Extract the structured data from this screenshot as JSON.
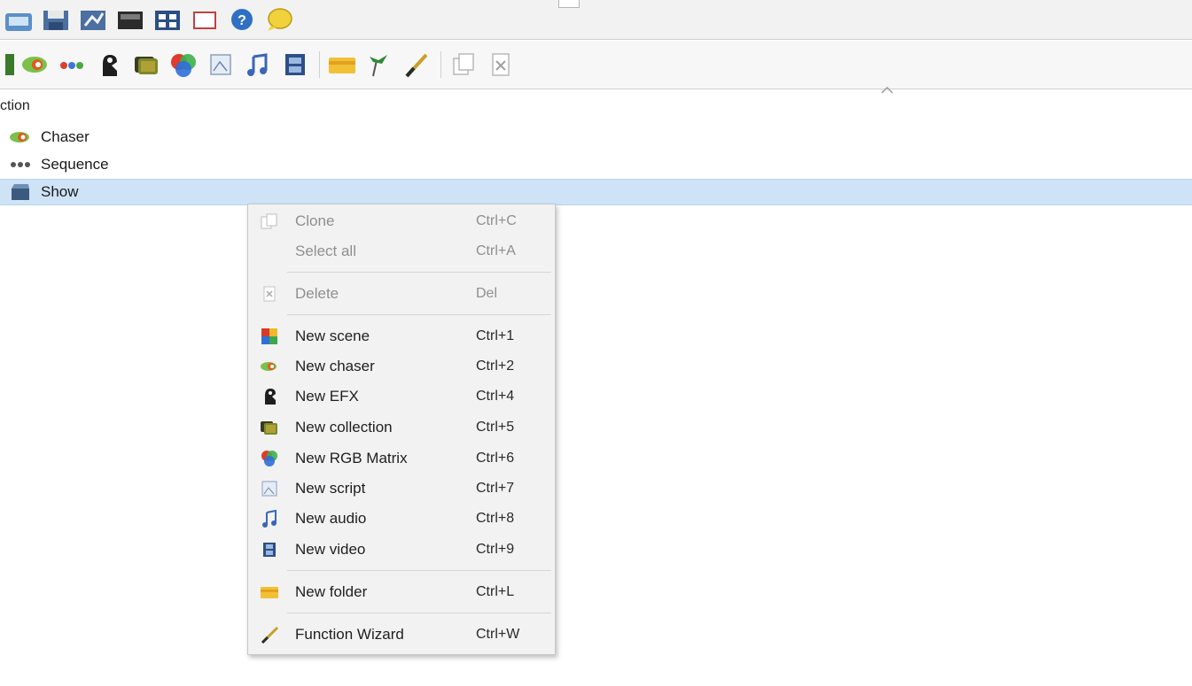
{
  "toolbar_top": {
    "icons": [
      "new-workspace-icon",
      "open-workspace-icon",
      "save-workspace-icon",
      "save-as-icon",
      "dmx-monitor-icon",
      "grid-view-icon",
      "fullscreen-icon",
      "help-icon",
      "speech-bubble-icon"
    ]
  },
  "toolbar_functions": {
    "icons": [
      "new-scene-icon",
      "new-chaser-icon",
      "new-sequence-icon",
      "new-efx-icon",
      "new-collection-icon",
      "new-rgb-matrix-icon",
      "new-script-icon",
      "new-audio-icon",
      "new-video-icon",
      "new-folder-icon",
      "function-wizard-icon",
      "clone-icon",
      "delete-icon"
    ]
  },
  "tree": {
    "header": "ction",
    "items": [
      {
        "label": "Chaser",
        "icon": "chaser-icon"
      },
      {
        "label": "Sequence",
        "icon": "sequence-icon"
      },
      {
        "label": "Show",
        "icon": "show-icon",
        "selected": true
      }
    ]
  },
  "context_menu": {
    "items": [
      {
        "label": "Clone",
        "shortcut": "Ctrl+C",
        "icon": "clone-icon",
        "enabled": false
      },
      {
        "label": "Select all",
        "shortcut": "Ctrl+A",
        "icon": "",
        "enabled": false
      },
      {
        "label": "Delete",
        "shortcut": "Del",
        "icon": "delete-icon",
        "enabled": false
      },
      {
        "label": "New scene",
        "shortcut": "Ctrl+1",
        "icon": "new-scene-icon",
        "enabled": true
      },
      {
        "label": "New chaser",
        "shortcut": "Ctrl+2",
        "icon": "new-chaser-icon",
        "enabled": true
      },
      {
        "label": "New EFX",
        "shortcut": "Ctrl+4",
        "icon": "new-efx-icon",
        "enabled": true
      },
      {
        "label": "New collection",
        "shortcut": "Ctrl+5",
        "icon": "new-collection-icon",
        "enabled": true
      },
      {
        "label": "New RGB Matrix",
        "shortcut": "Ctrl+6",
        "icon": "new-rgb-matrix-icon",
        "enabled": true
      },
      {
        "label": "New script",
        "shortcut": "Ctrl+7",
        "icon": "new-script-icon",
        "enabled": true
      },
      {
        "label": "New audio",
        "shortcut": "Ctrl+8",
        "icon": "new-audio-icon",
        "enabled": true
      },
      {
        "label": "New video",
        "shortcut": "Ctrl+9",
        "icon": "new-video-icon",
        "enabled": true
      },
      {
        "label": "New folder",
        "shortcut": "Ctrl+L",
        "icon": "new-folder-icon",
        "enabled": true
      },
      {
        "label": "Function Wizard",
        "shortcut": "Ctrl+W",
        "icon": "function-wizard-icon",
        "enabled": true
      }
    ]
  },
  "colors": {
    "selection": "#cfe3f7",
    "menu_bg": "#f2f2f2",
    "disabled_text": "#8f8f8f"
  }
}
